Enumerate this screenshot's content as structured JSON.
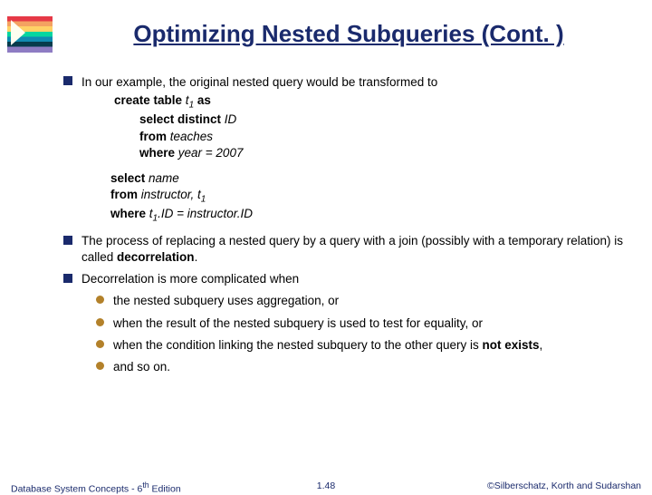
{
  "title": "Optimizing Nested Subqueries (Cont. )",
  "bullet1": {
    "lead": "In our example, the original nested query would be transformed to",
    "code1_l1_a": "create table ",
    "code1_l1_b": "t",
    "code1_l1_c": " as",
    "code1_l2_a": "select distinct ",
    "code1_l2_b": "ID",
    "code1_l3_a": "from ",
    "code1_l3_b": "teaches",
    "code1_l4_a": "where ",
    "code1_l4_b": "year = 2007",
    "code2_l1_a": "select ",
    "code2_l1_b": "name",
    "code2_l2_a": "from ",
    "code2_l2_b": "instructor, t",
    "code2_l3_a": " where ",
    "code2_l3_b": "t",
    "code2_l3_c": ".ID = instructor.ID"
  },
  "bullet2_a": "The process of replacing a nested query by a query with a join (possibly with a temporary relation) is called ",
  "bullet2_b": "decorrelation",
  "bullet2_c": ".",
  "bullet3": "Decorrelation is more complicated when",
  "sub1": "the nested subquery uses aggregation, or",
  "sub2": "when the result of the nested subquery is used to test for equality, or",
  "sub3_a": "when the condition linking the nested subquery to the other query is ",
  "sub3_b": "not exists",
  "sub3_c": ",",
  "sub4": "and so on.",
  "footer": {
    "left_a": "Database System Concepts - 6",
    "left_b": " Edition",
    "left_sup": "th",
    "center": "1.48",
    "right": "©Silberschatz, Korth and Sudarshan"
  },
  "sub_one": "1"
}
